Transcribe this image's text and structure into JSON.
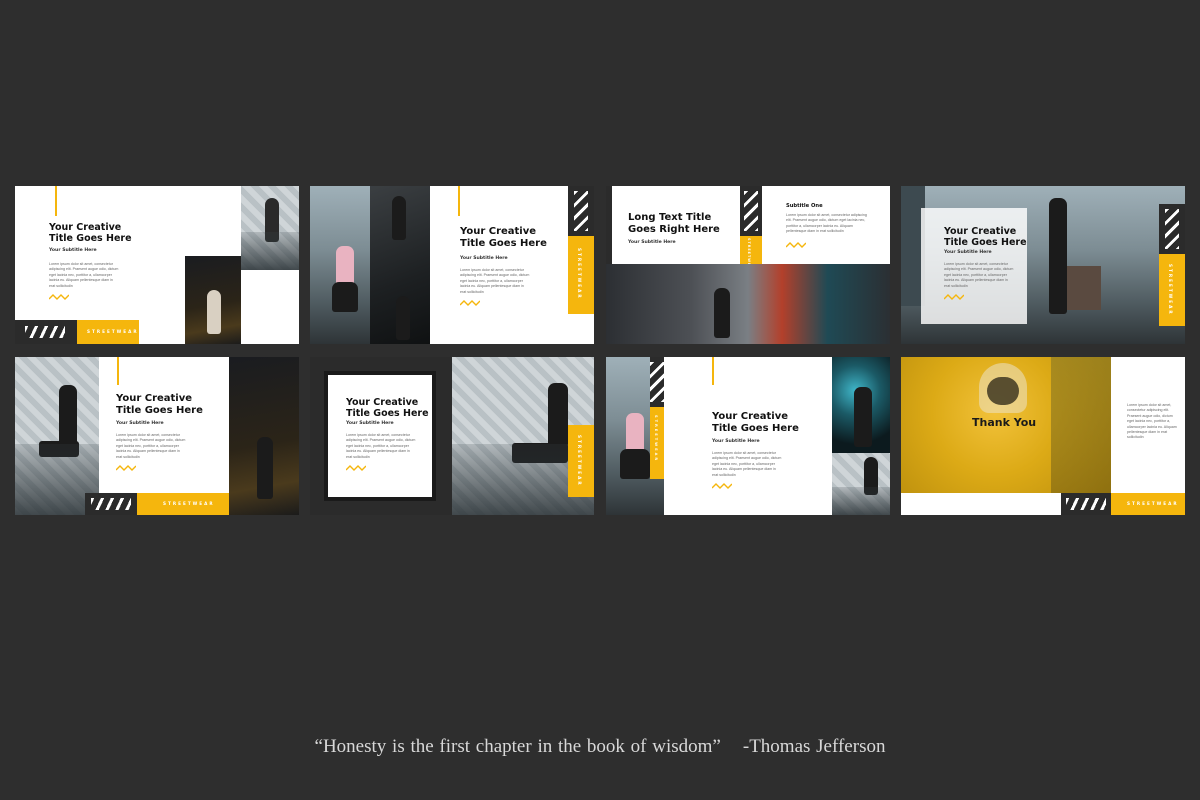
{
  "slides": [
    {
      "title": "Your Creative\nTitle Goes Here",
      "subtitle": "Your Subtitle Here",
      "brand": "STREETWEAR",
      "body": "Lorem ipsum dolor sit amet, consectetur adipiscing elit. Praesent augue odio, dictum eget lacinia nec, porttitor a, ullamcorper lacinia eu. Aliquam pellentesque diam in erat sollicitudin"
    },
    {
      "title": "Your Creative\nTitle Goes Here",
      "subtitle": "Your Subtitle Here",
      "brand": "STREETWEAR",
      "body": "Lorem ipsum dolor sit amet, consectetur adipiscing elit. Praesent augue odio, dictum eget lacinia nec, porttitor a, ullamcorper lacinia eu. Aliquam pellentesque diam in erat sollicitudin"
    },
    {
      "title": "Long Text Title\nGoes Right Here",
      "subtitle": "Your Subtitle Here",
      "subtitle2": "Subtitle One",
      "brand": "STREETWEAR",
      "body": "Lorem ipsum dolor sit amet, consectetur adipiscing elit. Praesent augue odio, dictum eget lacinia nec, porttitor a, ullamcorper lacinia eu. Aliquam pellentesque diam in erat sollicitudin"
    },
    {
      "title": "Your Creative\nTitle Goes Here",
      "subtitle": "Your Subtitle Here",
      "brand": "STREETWEAR",
      "body": "Lorem ipsum dolor sit amet, consectetur adipiscing elit. Praesent augue odio, dictum eget lacinia nec, porttitor a, ullamcorper lacinia eu. Aliquam pellentesque diam in erat sollicitudin"
    },
    {
      "title": "Your Creative\nTitle Goes Here",
      "subtitle": "Your Subtitle Here",
      "brand": "STREETWEAR",
      "body": "Lorem ipsum dolor sit amet, consectetur adipiscing elit. Praesent augue odio, dictum eget lacinia nec, porttitor a, ullamcorper lacinia eu. Aliquam pellentesque diam in erat sollicitudin"
    },
    {
      "title": "Your Creative\nTitle Goes Here",
      "subtitle": "Your Subtitle Here",
      "brand": "STREETWEAR",
      "body": "Lorem ipsum dolor sit amet, consectetur adipiscing elit. Praesent augue odio, dictum eget lacinia nec, porttitor a, ullamcorper lacinia eu. Aliquam pellentesque diam in erat sollicitudin"
    },
    {
      "title": "Your Creative\nTitle Goes Here",
      "subtitle": "Your Subtitle Here",
      "brand": "STREETWEAR",
      "body": "Lorem ipsum dolor sit amet, consectetur adipiscing elit. Praesent augue odio, dictum eget lacinia nec, porttitor a, ullamcorper lacinia eu. Aliquam pellentesque diam in erat sollicitudin"
    },
    {
      "title": "Thank You",
      "brand": "STREETWEAR",
      "body": "Lorem ipsum dolor sit amet, consectetur adipiscing elit. Praesent augue odio, dictum eget lacinia nec, porttitor a, ullamcorper lacinia eu. Aliquam pellentesque diam in erat sollicitudin"
    }
  ],
  "quote": {
    "text": "“Honesty is the first chapter in the book of wisdom”",
    "author": "-Thomas Jefferson"
  },
  "colors": {
    "accent": "#f5b60d",
    "dark": "#2b2b2b",
    "background": "#2e2e2e"
  }
}
